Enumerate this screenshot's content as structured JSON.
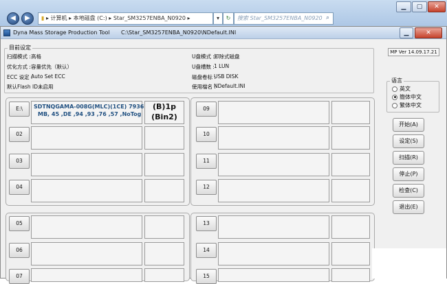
{
  "explorer": {
    "breadcrumb": [
      "计算机",
      "本地磁盘 (C:)",
      "Star_SM3257ENBA_N0920"
    ],
    "search_placeholder": "搜索 Star_SM3257ENBA_N0920"
  },
  "window": {
    "title": "Dyna Mass Storage Production Tool",
    "path": "C:\\Star_SM3257ENBA_N0920\\NDefault.INI"
  },
  "settings": {
    "legend": "目前设定",
    "left": [
      {
        "label": "扫描模式 :",
        "value": "高格"
      },
      {
        "label": "优化方式 :",
        "value": "容量优先（默认）"
      },
      {
        "label": "ECC 设定 :",
        "value": "Auto Set ECC"
      },
      {
        "label": "默认Flash ID :",
        "value": "未启用"
      }
    ],
    "right": [
      {
        "label": "U盘模式 :",
        "value": "卸除式磁盘"
      },
      {
        "label": "U盘槽数 :",
        "value": "1 LUN"
      },
      {
        "label": "磁盘卷标 :",
        "value": "USB DISK"
      },
      {
        "label": "使用檔名 :",
        "value": "NDefault.INI"
      }
    ]
  },
  "version": "MP Ver 14.09.17.21",
  "language": {
    "legend": "语言",
    "options": [
      "英文",
      "簡体中文",
      "繁体中文"
    ],
    "selected": 1
  },
  "actions": [
    "开始(A)",
    "设定(S)",
    "扫描(R)",
    "停止(P)",
    "检查(C)",
    "退出(E)"
  ],
  "slots": {
    "s01": {
      "label": "E:\\",
      "detail_line1": "SDTNQGAMA-008G(MLC)(1CE) 7936",
      "detail_line2": "MB, 45 ,DE ,94 ,93 ,76 ,57 ,NoTog",
      "bin_line1": "(B)1p",
      "bin_line2": "(Bin2)"
    },
    "s02": {
      "label": "02"
    },
    "s03": {
      "label": "03"
    },
    "s04": {
      "label": "04"
    },
    "s05": {
      "label": "05"
    },
    "s06": {
      "label": "06"
    },
    "s07": {
      "label": "07"
    },
    "s09": {
      "label": "09"
    },
    "s10": {
      "label": "10"
    },
    "s11": {
      "label": "11"
    },
    "s12": {
      "label": "12"
    },
    "s13": {
      "label": "13"
    },
    "s14": {
      "label": "14"
    },
    "s15": {
      "label": "15"
    }
  }
}
